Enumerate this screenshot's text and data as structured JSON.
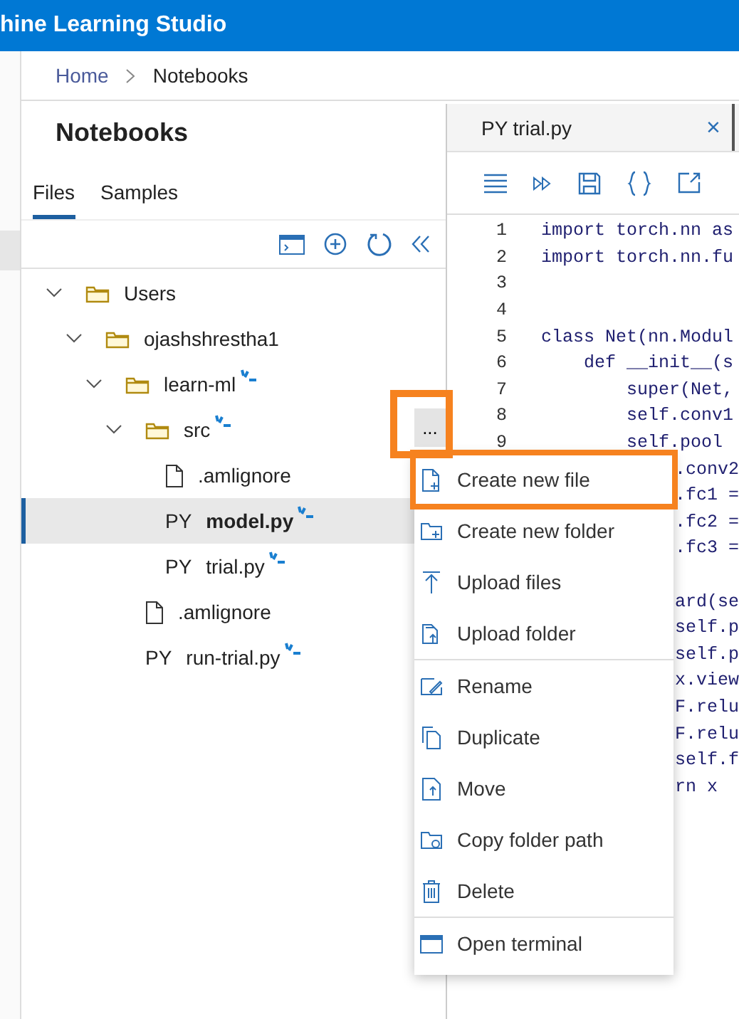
{
  "app_bar": {
    "title": "hine Learning Studio"
  },
  "breadcrumb": [
    "Home",
    "Notebooks"
  ],
  "panel": {
    "title": "Notebooks",
    "tabs": [
      {
        "label": "Files",
        "selected": true
      },
      {
        "label": "Samples",
        "selected": false
      }
    ]
  },
  "tree": [
    {
      "kind": "folder",
      "name": "Users",
      "expanded": true,
      "marker": false,
      "selected": false,
      "children": [
        {
          "kind": "folder",
          "name": "ojashshrestha1",
          "expanded": true,
          "marker": false,
          "selected": false,
          "children": [
            {
              "kind": "folder",
              "name": "learn-ml",
              "expanded": true,
              "marker": true,
              "selected": false,
              "children": [
                {
                  "kind": "folder",
                  "name": "src",
                  "expanded": true,
                  "marker": true,
                  "selected": false,
                  "more": {
                    "label": "...",
                    "highlighted": true
                  },
                  "children": [
                    {
                      "kind": "file",
                      "name": ".amlignore",
                      "marker": false,
                      "selected": false
                    },
                    {
                      "kind": "py",
                      "type_label": "PY",
                      "name": "model.py",
                      "marker": true,
                      "selected": true
                    },
                    {
                      "kind": "py",
                      "type_label": "PY",
                      "name": "trial.py",
                      "marker": true,
                      "selected": false
                    }
                  ]
                },
                {
                  "kind": "file",
                  "name": ".amlignore",
                  "marker": false,
                  "selected": false
                },
                {
                  "kind": "py",
                  "type_label": "PY",
                  "name": "run-trial.py",
                  "marker": true,
                  "selected": false
                }
              ]
            }
          ]
        }
      ]
    }
  ],
  "editor": {
    "tab": {
      "type_label": "PY",
      "name": "trial.py",
      "close": "×"
    },
    "lines": [
      {
        "kind": "full",
        "number": "1",
        "text": "import torch.nn as"
      },
      {
        "kind": "full",
        "number": "2",
        "text": "import torch.nn.fu"
      },
      {
        "kind": "full",
        "number": "3"
      },
      {
        "kind": "full",
        "number": "4"
      },
      {
        "kind": "full",
        "number": "5",
        "text": "class Net(nn.Modul"
      },
      {
        "kind": "full",
        "number": "6",
        "text": "    def __init__(s"
      },
      {
        "kind": "full",
        "number": "7",
        "text": "        super(Net,"
      },
      {
        "kind": "full",
        "number": "8",
        "text": "        self.conv1"
      },
      {
        "kind": "full",
        "number": "9",
        "text": "        self.pool"
      },
      {
        "kind": "covered",
        "text": ".conv2"
      },
      {
        "kind": "covered",
        "text": ".fc1 ="
      },
      {
        "kind": "covered",
        "text": ".fc2 ="
      },
      {
        "kind": "covered",
        "text": ".fc3 ="
      },
      {
        "kind": "covered"
      },
      {
        "kind": "covered",
        "text": "ard(se"
      },
      {
        "kind": "covered",
        "text": "self.p"
      },
      {
        "kind": "covered",
        "text": "self.p"
      },
      {
        "kind": "covered",
        "text": "x.view"
      },
      {
        "kind": "covered",
        "text": "F.relu"
      },
      {
        "kind": "covered",
        "text": "F.relu"
      },
      {
        "kind": "covered",
        "text": "self.f"
      },
      {
        "kind": "covered",
        "text": "rn x"
      }
    ]
  },
  "context_menu": {
    "groups": [
      [
        {
          "label": "Create new file",
          "highlighted": true
        },
        {
          "label": "Create new folder",
          "highlighted": false
        },
        {
          "label": "Upload files",
          "highlighted": false
        },
        {
          "label": "Upload folder",
          "highlighted": false
        }
      ],
      [
        {
          "label": "Rename",
          "highlighted": false
        },
        {
          "label": "Duplicate",
          "highlighted": false
        },
        {
          "label": "Move",
          "highlighted": false
        },
        {
          "label": "Copy folder path",
          "highlighted": false
        },
        {
          "label": "Delete",
          "highlighted": false
        }
      ],
      [
        {
          "label": "Open terminal",
          "highlighted": false
        }
      ]
    ]
  }
}
